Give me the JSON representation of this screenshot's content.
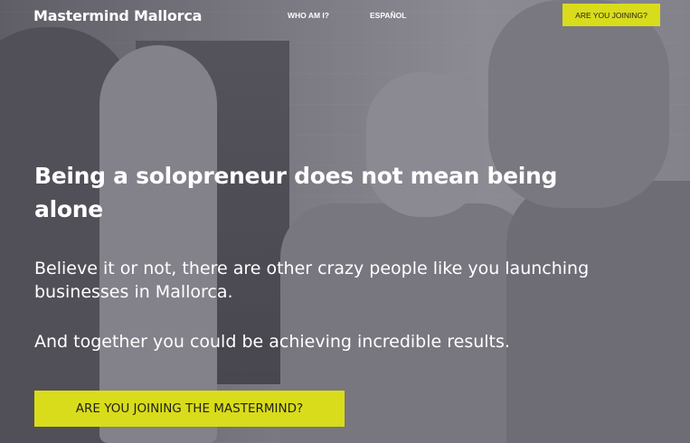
{
  "nav": {
    "brand": "Mastermind Mallorca",
    "links": [
      "WHO AM I?",
      "ESPAÑOL"
    ],
    "cta_label": "ARE YOU JOINING?"
  },
  "hero": {
    "headline": "Being a solopreneur does not mean being alone",
    "paragraph1": "Believe it or not, there are other crazy people like you launching businesses in Mallorca.",
    "paragraph2": "And together you could be achieving incredible results.",
    "cta_label": "ARE YOU JOINING THE MASTERMIND?"
  },
  "colors": {
    "accent": "#d9dc1a",
    "text": "#ffffff",
    "cta_text": "#222222"
  }
}
